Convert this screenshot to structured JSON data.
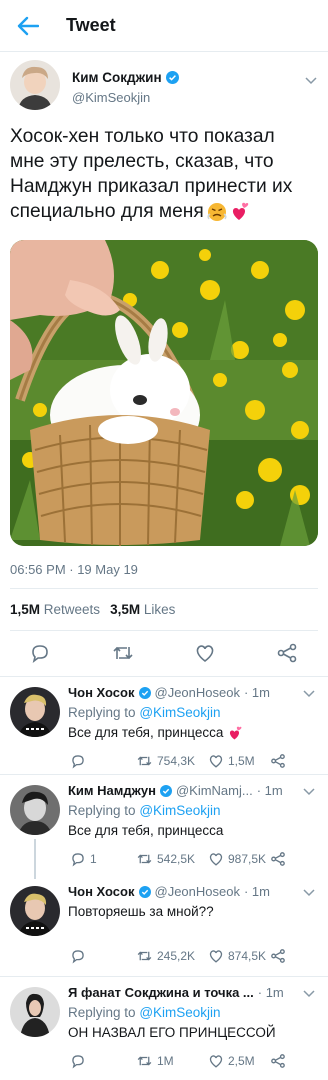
{
  "header": {
    "title": "Tweet"
  },
  "tweet": {
    "author_name": "Ким Сокджин",
    "author_handle": "@KimSeokjin",
    "text_lines": [
      "Хосок-хен только что показал",
      "мне эту прелесть, сказав, что",
      "Намджун приказал принести их",
      "специально для меня"
    ],
    "timestamp": "06:56 PM · 19 May 19",
    "retweets_count": "1,5M",
    "retweets_label": "Retweets",
    "likes_count": "3,5M",
    "likes_label": "Likes"
  },
  "replies": [
    {
      "name": "Чон Хосок",
      "handle": "@JeonHoseok",
      "time": "· 1m",
      "replying_prefix": "Replying to",
      "replying_to": "@KimSeokjin",
      "text": "Все для тебя, принцесса",
      "reply_count": "",
      "retweet_count": "754,3K",
      "like_count": "1,5M"
    },
    {
      "name": "Ким Намджун",
      "handle": "@KimNamj...",
      "time": "· 1m",
      "replying_prefix": "Replying to",
      "replying_to": "@KimSeokjin",
      "text": "Все для тебя, принцесса",
      "reply_count": "1",
      "retweet_count": "542,5K",
      "like_count": "987,5K"
    },
    {
      "name": "Чон Хосок",
      "handle": "@JeonHoseok",
      "time": "· 1m",
      "replying_prefix": "",
      "replying_to": "",
      "text": "Повторяешь за мной??",
      "reply_count": "",
      "retweet_count": "245,2K",
      "like_count": "874,5K"
    },
    {
      "name": "Я фанат Сокджина и точка ...",
      "handle": "",
      "time": "· 1m",
      "replying_prefix": "Replying to",
      "replying_to": "@KimSeokjin",
      "text": "ОН НАЗВАЛ ЕГО ПРИНЦЕССОЙ",
      "reply_count": "",
      "retweet_count": "1M",
      "like_count": "2,5M"
    }
  ],
  "colors": {
    "accent": "#1da1f2",
    "text": "#14171a",
    "muted": "#657786",
    "border": "#e6ecf0"
  }
}
